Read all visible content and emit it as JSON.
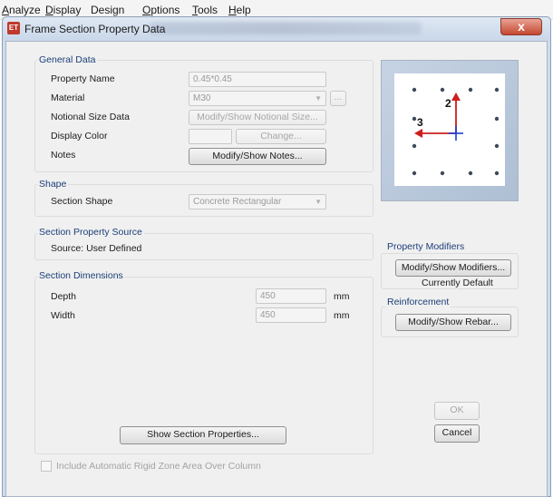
{
  "menu": {
    "items": [
      {
        "label_ul": "A",
        "label_rest": "nalyze"
      },
      {
        "label_ul": "",
        "label_pre": "D",
        "label_rest": "isplay"
      },
      {
        "label": "Design"
      },
      {
        "label_ul": "O",
        "label_rest": "ptions"
      },
      {
        "label_ul": "T",
        "label_rest": "ools"
      },
      {
        "label_ul": "H",
        "label_rest": "elp"
      }
    ]
  },
  "window": {
    "title": "Frame Section Property Data",
    "app_icon": "ET",
    "close_label": "x"
  },
  "general_data": {
    "title": "General Data",
    "property_name_label": "Property Name",
    "property_name_value": "0.45*0.45",
    "material_label": "Material",
    "material_value": "M30",
    "material_more_button": "...",
    "notional_size_label": "Notional Size Data",
    "notional_size_button": "Modify/Show Notional Size...",
    "display_color_label": "Display Color",
    "display_color_button": "Change...",
    "notes_label": "Notes",
    "notes_button": "Modify/Show Notes..."
  },
  "shape": {
    "title": "Shape",
    "section_shape_label": "Section Shape",
    "section_shape_value": "Concrete Rectangular"
  },
  "property_source": {
    "title": "Section Property Source",
    "source_text": "Source:  User Defined"
  },
  "dimensions": {
    "title": "Section Dimensions",
    "depth_label": "Depth",
    "depth_value": "450",
    "depth_unit": "mm",
    "width_label": "Width",
    "width_value": "450",
    "width_unit": "mm",
    "show_properties_button": "Show Section Properties..."
  },
  "preview": {
    "axis_2_label": "2",
    "axis_3_label": "3",
    "axis_color": "#cc1e1e",
    "origin_color": "#1a3fcf"
  },
  "property_modifiers": {
    "title": "Property Modifiers",
    "button": "Modify/Show Modifiers...",
    "status": "Currently Default"
  },
  "reinforcement": {
    "title": "Reinforcement",
    "button": "Modify/Show Rebar..."
  },
  "footer": {
    "ok_button": "OK",
    "cancel_button": "Cancel",
    "rigid_zone_checkbox_label": "Include Automatic Rigid Zone Area Over Column",
    "rigid_zone_checked": false
  }
}
